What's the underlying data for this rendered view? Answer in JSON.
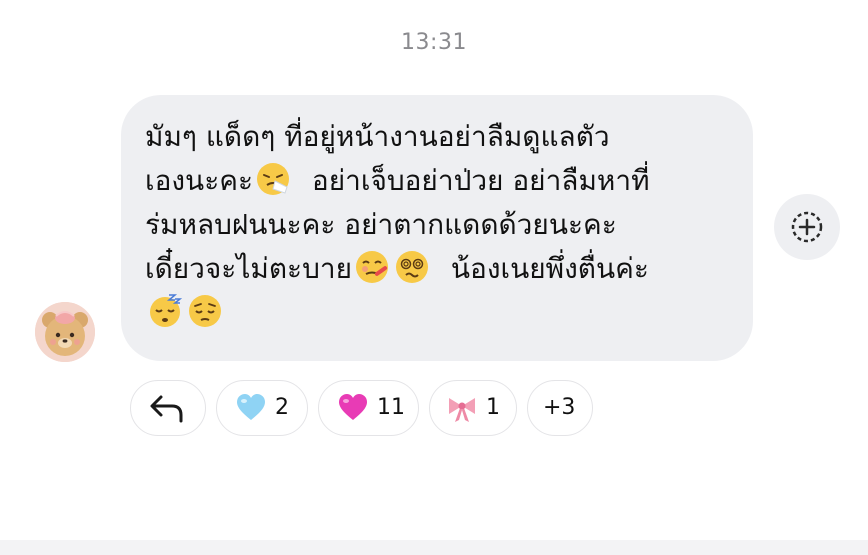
{
  "timestamp": "13:31",
  "message": {
    "lines": [
      "มัมๆ แด็ดๆ ที่อยู่หน้างานอย่าลืมดูแลตัว",
      "เองนะคะ",
      "อย่าเจ็บอย่าป่วย อย่าลืมหาที่",
      "ร่มหลบฝนนะคะ อย่าตากแดดด้วยนะคะ",
      "เดี๋ยวจะไม่ตะบาย",
      "น้องเนยพึ่งตื่นค่ะ"
    ],
    "emojis": [
      "sneezing-face",
      "face-with-thermometer",
      "face-with-spiral-eyes",
      "sleeping-face",
      "pensive-face"
    ]
  },
  "reactions": {
    "reply_icon": "reply-arrow-icon",
    "items": [
      {
        "emoji": "light-blue-heart",
        "count": "2"
      },
      {
        "emoji": "pink-heart",
        "count": "11"
      },
      {
        "emoji": "ribbon-bow",
        "count": "1"
      }
    ],
    "more": "+3"
  },
  "react_button_icon": "add-reaction-icon",
  "colors": {
    "bubble": "#eeeff2",
    "timestamp": "#8a8a8e",
    "chip_border": "#e4e4e7",
    "light_blue_heart": "#8fd3f4",
    "pink_heart": "#e83bb5",
    "bow": "#f39fb6"
  }
}
